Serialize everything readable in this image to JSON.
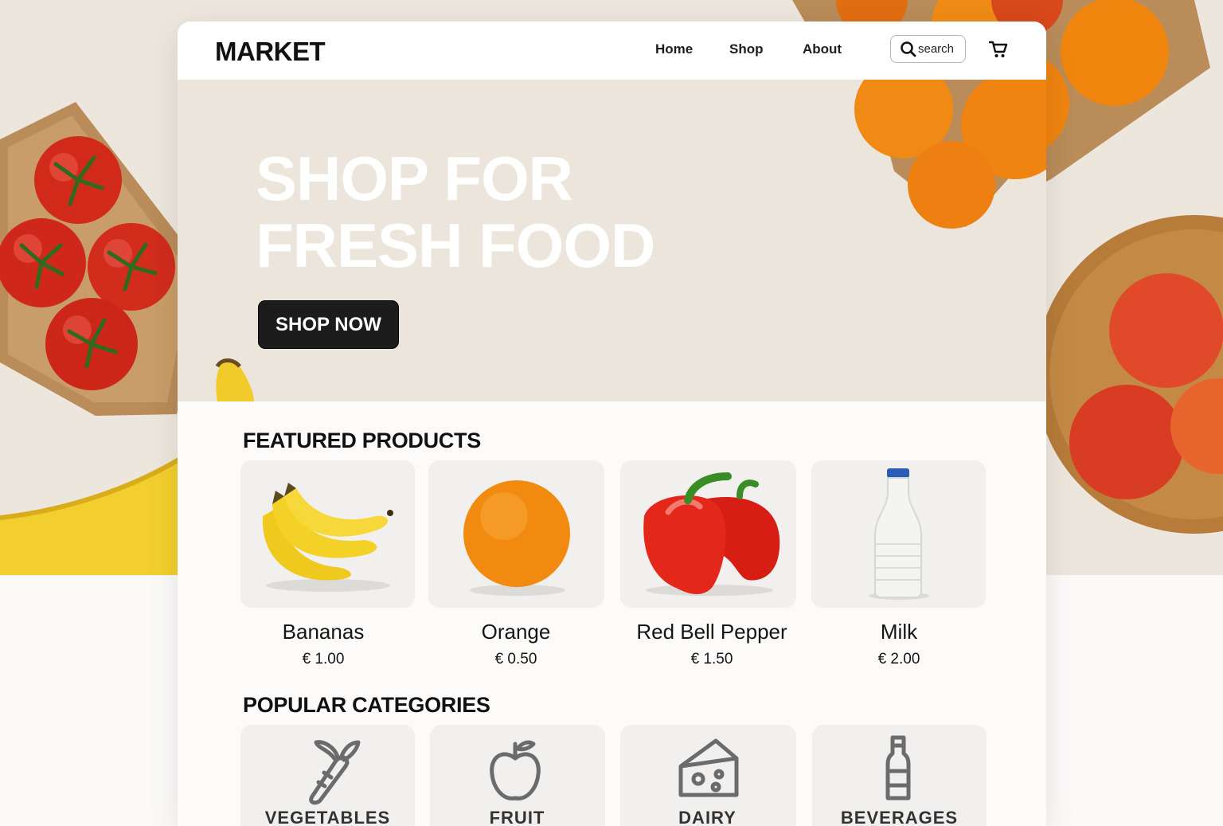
{
  "header": {
    "logo": "MARKET",
    "nav": [
      {
        "label": "Home"
      },
      {
        "label": "Shop"
      },
      {
        "label": "About"
      }
    ],
    "search_label": "search",
    "cart_icon": "cart-icon"
  },
  "hero": {
    "title_line1": "SHOP FOR",
    "title_line2": "FRESH FOOD",
    "cta_label": "SHOP NOW"
  },
  "featured": {
    "title": "FEATURED PRODUCTS",
    "products": [
      {
        "name": "Bananas",
        "price": "€ 1.00",
        "icon": "banana-image"
      },
      {
        "name": "Orange",
        "price": "€ 0.50",
        "icon": "orange-image"
      },
      {
        "name": "Red Bell Pepper",
        "price": "€ 1.50",
        "icon": "bell-pepper-image"
      },
      {
        "name": "Milk",
        "price": "€ 2.00",
        "icon": "milk-bottle-image"
      }
    ]
  },
  "categories": {
    "title": "POPULAR CATEGORIES",
    "items": [
      {
        "label": "VEGETABLES",
        "icon": "carrot-icon"
      },
      {
        "label": "FRUIT",
        "icon": "apple-icon"
      },
      {
        "label": "DAIRY",
        "icon": "cheese-icon"
      },
      {
        "label": "BEVERAGES",
        "icon": "bottle-icon"
      }
    ]
  },
  "colors": {
    "background": "#ede6dc",
    "button": "#1c1c1c",
    "card": "#f1f0ee"
  }
}
